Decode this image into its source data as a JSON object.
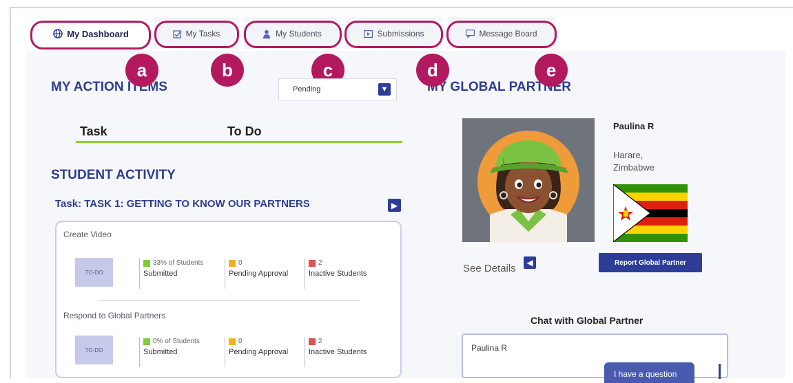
{
  "tabs": [
    {
      "label": "My Dashboard",
      "icon": "globe-icon",
      "marker": "a"
    },
    {
      "label": "My Tasks",
      "icon": "task-check-icon",
      "marker": "b"
    },
    {
      "label": "My Students",
      "icon": "person-icon",
      "marker": "c"
    },
    {
      "label": "Submissions",
      "icon": "play-box-icon",
      "marker": "d"
    },
    {
      "label": "Message Board",
      "icon": "chat-bubble-icon",
      "marker": "e"
    }
  ],
  "action_items": {
    "title": "MY ACTION ITEMS",
    "filter_value": "Pending",
    "columns": [
      "Task",
      "To Do"
    ]
  },
  "student_activity": {
    "title": "STUDENT ACTIVITY",
    "task_title": "Task: TASK 1: GETTING TO KNOW OUR PARTNERS",
    "activities": [
      {
        "name": "Create Video",
        "box": "TO-DO",
        "submitted_pct": "33% of Students",
        "submitted_label": "Submitted",
        "pending_count": "0",
        "pending_label": "Pending Approval",
        "inactive_count": "2",
        "inactive_label": "Inactive Students"
      },
      {
        "name": "Respond to Global Partners",
        "box": "TO-DO",
        "submitted_pct": "0% of Students",
        "submitted_label": "Submitted",
        "pending_count": "0",
        "pending_label": "Pending Approval",
        "inactive_count": "2",
        "inactive_label": "Inactive Students"
      }
    ]
  },
  "global_partner": {
    "title": "MY GLOBAL PARTNER",
    "name": "Paulina R",
    "location": "Harare, Zimbabwe",
    "see_details": "See Details",
    "report_button": "Report Global Partner"
  },
  "chat": {
    "title": "Chat with Global Partner",
    "sender": "Paulina R",
    "message": "I have a question"
  },
  "colors": {
    "accent": "#b3195f",
    "primary": "#2d3d97",
    "heading": "#2f3d8f",
    "submitted": "#7ccc3a",
    "pending": "#f2b21b",
    "inactive": "#e05050",
    "divider": "#8fd12a"
  }
}
